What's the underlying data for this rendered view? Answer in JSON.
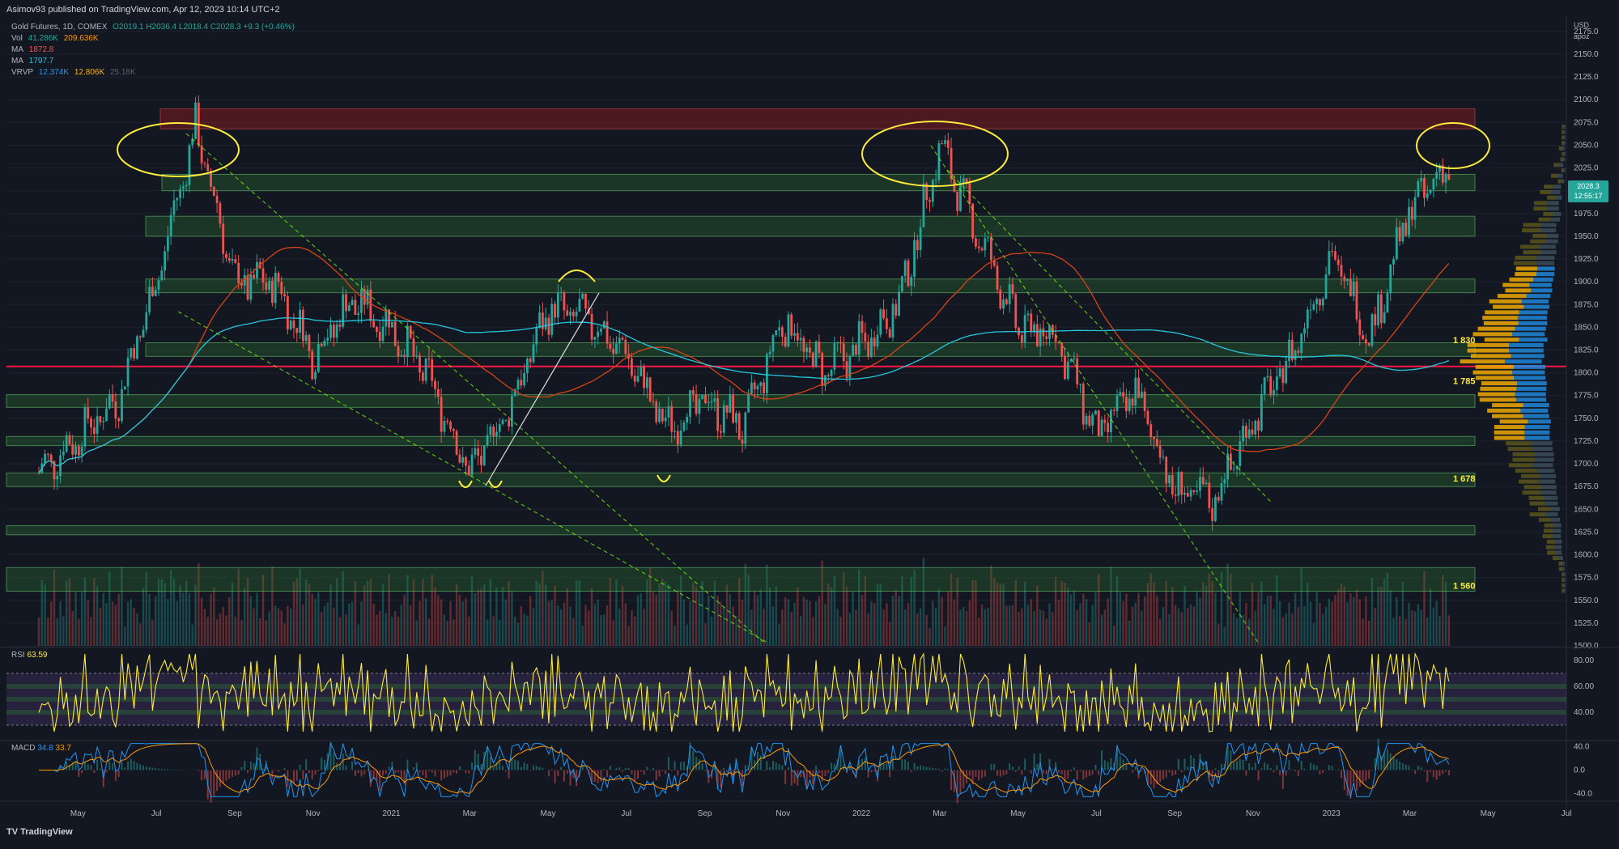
{
  "header": {
    "published": "Asimov93 published on TradingView.com, Apr 12, 2023 10:14 UTC+2"
  },
  "legend": {
    "symbol": "Gold Futures, 1D, COMEX",
    "ohlc": "O2019.1 H2036.4 L2018.4 C2028.3 +9.3 (+0.46%)",
    "vol_label": "Vol",
    "vol_a": "41.286K",
    "vol_b": "209.636K",
    "ma1_label": "MA",
    "ma1_value": "1872.8",
    "ma2_label": "MA",
    "ma2_value": "1797.7",
    "vrvp_label": "VRVP",
    "vrvp_a": "12.374K",
    "vrvp_b": "12.806K",
    "vrvp_c": "25.18K"
  },
  "price_axis": {
    "currency": "USD",
    "unit": "apoz",
    "current_price": "2028.3",
    "countdown": "12:55:17",
    "ticks": [
      "2175.0",
      "2150.0",
      "2125.0",
      "2100.0",
      "2075.0",
      "2050.0",
      "2025.0",
      "2000.0",
      "1975.0",
      "1950.0",
      "1925.0",
      "1900.0",
      "1875.0",
      "1850.0",
      "1825.0",
      "1800.0",
      "1775.0",
      "1750.0",
      "1725.0",
      "1700.0",
      "1675.0",
      "1650.0",
      "1625.0",
      "1600.0",
      "1575.0",
      "1550.0",
      "1525.0",
      "1500.0"
    ]
  },
  "level_labels": [
    "1 830",
    "1 785",
    "1 678",
    "1 560"
  ],
  "rsi": {
    "label": "RSI",
    "value": "63.59",
    "ticks": [
      "80.00",
      "60.00",
      "40.00"
    ]
  },
  "macd": {
    "label": "MACD",
    "value_a": "34.8",
    "value_b": "33.7",
    "ticks": [
      "40.0",
      "0.0",
      "-40.0"
    ]
  },
  "time_axis": [
    "May",
    "Jul",
    "Sep",
    "Nov",
    "2021",
    "Mar",
    "May",
    "Jul",
    "Sep",
    "Nov",
    "2022",
    "Mar",
    "May",
    "Jul",
    "Sep",
    "Nov",
    "2023",
    "Mar",
    "May",
    "Jul"
  ],
  "brand": "TradingView",
  "colors": {
    "background": "#131722",
    "up": "#26a69a",
    "down": "#ef5350",
    "zone_green": "#2e7d32",
    "zone_red": "#b71c1c",
    "support_line": "#ff1744",
    "annotation": "#ffeb3b",
    "ma_fast": "#d84315",
    "ma_slow": "#26c6da",
    "rsi_line": "#ffeb3b",
    "macd_line": "#2196f3",
    "signal_line": "#ff9800"
  },
  "chart_data": {
    "type": "candlestick",
    "instrument": "Gold Futures, 1D, COMEX",
    "ylim": [
      1500,
      2190
    ],
    "key_points": [
      {
        "x": "2020-04",
        "y": 1690
      },
      {
        "x": "2020-05",
        "y": 1730
      },
      {
        "x": "2020-06",
        "y": 1770
      },
      {
        "x": "2020-07",
        "y": 1900
      },
      {
        "x": "2020-08",
        "y": 2070
      },
      {
        "x": "2020-09",
        "y": 1900
      },
      {
        "x": "2020-10",
        "y": 1900
      },
      {
        "x": "2020-11",
        "y": 1820
      },
      {
        "x": "2020-12",
        "y": 1880
      },
      {
        "x": "2021-01",
        "y": 1850
      },
      {
        "x": "2021-02",
        "y": 1790
      },
      {
        "x": "2021-03",
        "y": 1690
      },
      {
        "x": "2021-04",
        "y": 1760
      },
      {
        "x": "2021-05",
        "y": 1870
      },
      {
        "x": "2021-06",
        "y": 1860
      },
      {
        "x": "2021-07",
        "y": 1820
      },
      {
        "x": "2021-08",
        "y": 1740
      },
      {
        "x": "2021-09",
        "y": 1770
      },
      {
        "x": "2021-10",
        "y": 1740
      },
      {
        "x": "2021-11",
        "y": 1860
      },
      {
        "x": "2021-12",
        "y": 1800
      },
      {
        "x": "2022-01",
        "y": 1830
      },
      {
        "x": "2022-02",
        "y": 1880
      },
      {
        "x": "2022-03",
        "y": 2050
      },
      {
        "x": "2022-04",
        "y": 1950
      },
      {
        "x": "2022-05",
        "y": 1850
      },
      {
        "x": "2022-06",
        "y": 1840
      },
      {
        "x": "2022-07",
        "y": 1730
      },
      {
        "x": "2022-08",
        "y": 1780
      },
      {
        "x": "2022-09",
        "y": 1670
      },
      {
        "x": "2022-10",
        "y": 1660
      },
      {
        "x": "2022-11",
        "y": 1750
      },
      {
        "x": "2022-12",
        "y": 1820
      },
      {
        "x": "2023-01",
        "y": 1930
      },
      {
        "x": "2023-02",
        "y": 1840
      },
      {
        "x": "2023-03",
        "y": 1980
      },
      {
        "x": "2023-04",
        "y": 2028.3
      }
    ],
    "zones": [
      {
        "type": "resistance",
        "from": 2068,
        "to": 2090
      },
      {
        "type": "support",
        "from": 2000,
        "to": 2018
      },
      {
        "type": "support",
        "from": 1950,
        "to": 1972
      },
      {
        "type": "support",
        "from": 1888,
        "to": 1903
      },
      {
        "type": "support",
        "from": 1818,
        "to": 1833
      },
      {
        "type": "support",
        "from": 1762,
        "to": 1776
      },
      {
        "type": "support",
        "from": 1720,
        "to": 1730
      },
      {
        "type": "support",
        "from": 1675,
        "to": 1690
      },
      {
        "type": "support",
        "from": 1622,
        "to": 1632
      },
      {
        "type": "support",
        "from": 1560,
        "to": 1586
      }
    ],
    "horizontal_line": 1807,
    "rsi_range": [
      20,
      90
    ],
    "macd_range": [
      -50,
      50
    ]
  }
}
